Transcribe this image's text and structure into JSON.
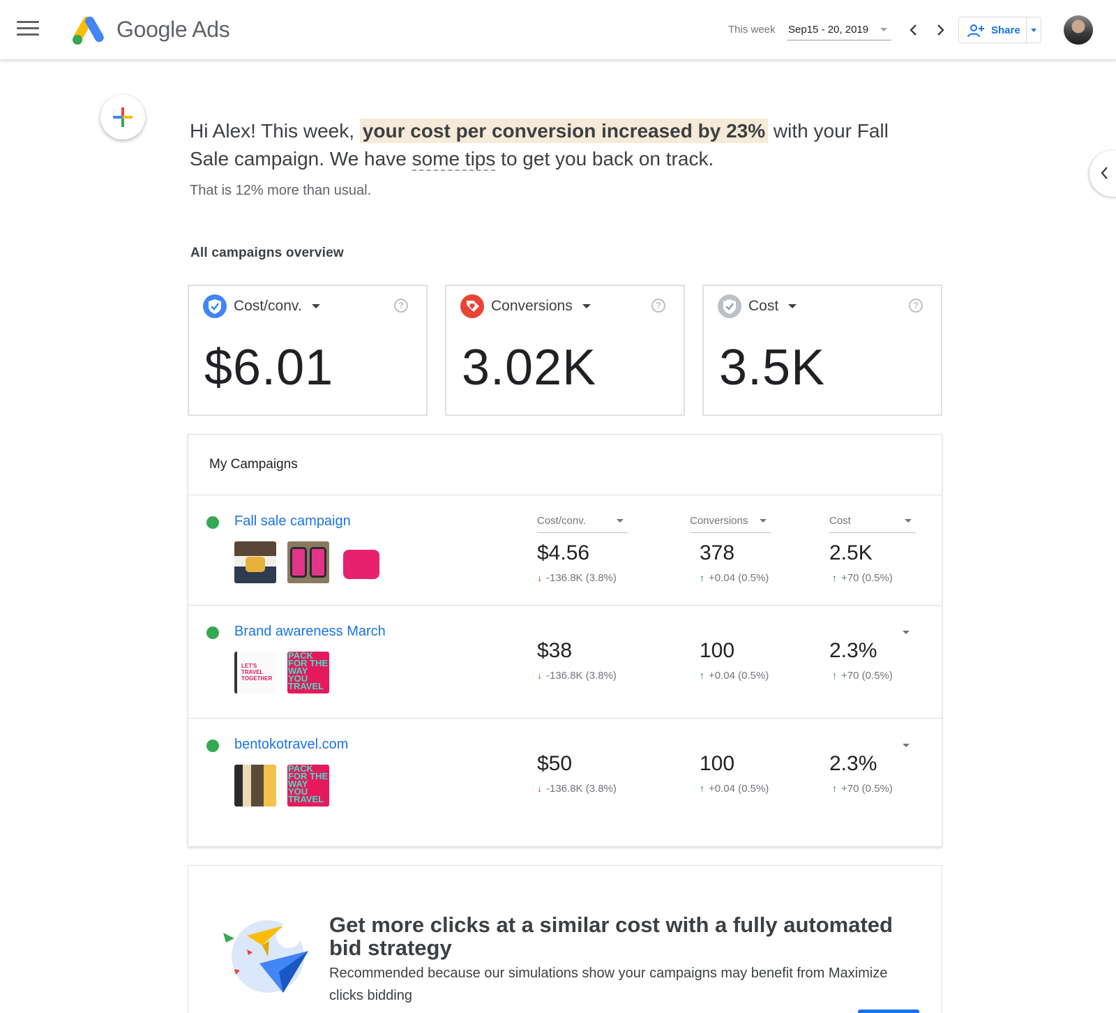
{
  "header": {
    "brand": "Google Ads",
    "week_label": "This week",
    "date_range": "Sep15 - 20, 2019",
    "share_label": "Share"
  },
  "greeting": {
    "part1": "Hi Alex! This week, ",
    "highlight": "your cost per conversion increased by 23%",
    "part2": " with your Fall Sale campaign. We have ",
    "tips_link": "some tips",
    "part3": " to get you back on track.",
    "subtext": "That is 12% more than usual."
  },
  "overview": {
    "title": "All campaigns overview",
    "cards": [
      {
        "label": "Cost/conv.",
        "value": "$6.01",
        "icon": "shield-check-icon",
        "color": "#4285f4"
      },
      {
        "label": "Conversions",
        "value": "3.02K",
        "icon": "heart-tag-icon",
        "color": "#ea4335"
      },
      {
        "label": "Cost",
        "value": "3.5K",
        "icon": "check-badge-icon",
        "color": "#9aa0a6"
      }
    ]
  },
  "campaigns": {
    "title": "My Campaigns",
    "columns": [
      "Cost/conv.",
      "Conversions",
      "Cost"
    ],
    "rows": [
      {
        "name": "Fall sale campaign",
        "status_color": "#34a853",
        "metrics": [
          {
            "value": "$4.56",
            "delta": "-136.8K (3.8%)",
            "direction": "down"
          },
          {
            "value": "378",
            "delta": "+0.04 (0.5%)",
            "direction": "up"
          },
          {
            "value": "2.5K",
            "delta": "+70 (0.5%)",
            "direction": "up"
          }
        ]
      },
      {
        "name": "Brand awareness March",
        "status_color": "#34a853",
        "thumb_text": [
          "LET'S TRAVEL TOGETHER",
          "PACK FOR THE WAY YOU TRAVEL"
        ],
        "metrics": [
          {
            "value": "$38",
            "delta": "-136.8K (3.8%)",
            "direction": "down"
          },
          {
            "value": "100",
            "delta": "+0.04 (0.5%)",
            "direction": "up"
          },
          {
            "value": "2.3%",
            "delta": "+70 (0.5%)",
            "direction": "up"
          }
        ]
      },
      {
        "name": "bentokotravel.com",
        "status_color": "#34a853",
        "thumb_text": [
          "PACK FOR THE WAY YOU TRAVEL"
        ],
        "metrics": [
          {
            "value": "$50",
            "delta": "-136.8K (3.8%)",
            "direction": "down"
          },
          {
            "value": "100",
            "delta": "+0.04 (0.5%)",
            "direction": "up"
          },
          {
            "value": "2.3%",
            "delta": "+70 (0.5%)",
            "direction": "up"
          }
        ]
      }
    ]
  },
  "recommendation": {
    "headline": "Get more clicks at a similar cost with a fully automated bid strategy",
    "description": "Recommended because our simulations show your campaigns may benefit from Maximize clicks bidding"
  },
  "colors": {
    "accent": "#1a73e8",
    "positive": "#188038",
    "negative": "#d93025",
    "highlight": "#f6ead8"
  }
}
